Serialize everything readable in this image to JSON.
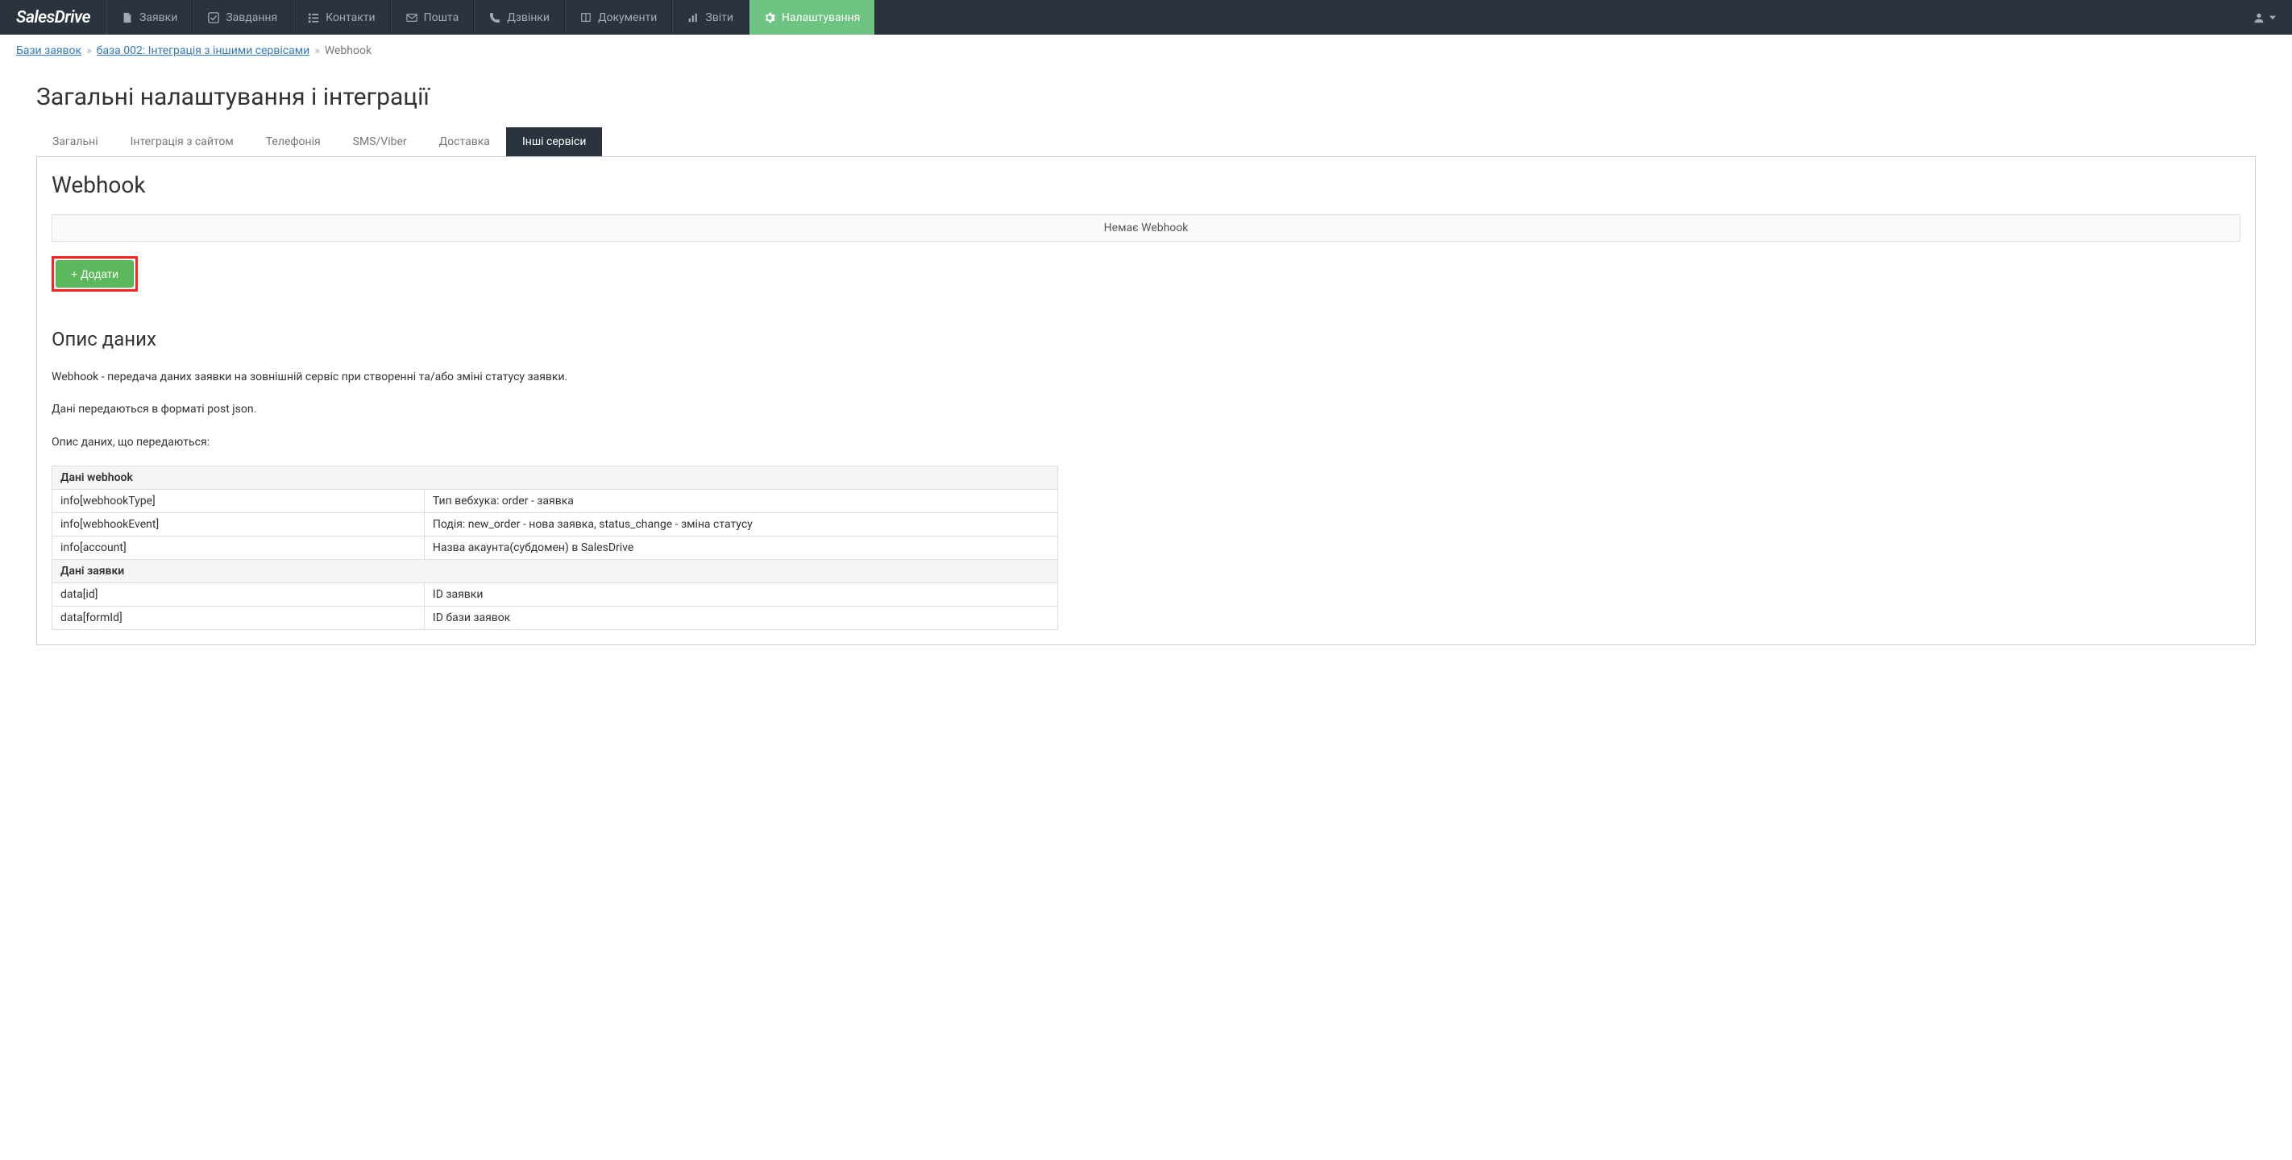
{
  "logo": "SalesDrive",
  "nav": [
    {
      "label": "Заявки",
      "icon": "file"
    },
    {
      "label": "Завдання",
      "icon": "check"
    },
    {
      "label": "Контакти",
      "icon": "list"
    },
    {
      "label": "Пошта",
      "icon": "mail"
    },
    {
      "label": "Дзвінки",
      "icon": "phone"
    },
    {
      "label": "Документи",
      "icon": "book"
    },
    {
      "label": "Звіти",
      "icon": "chart"
    },
    {
      "label": "Налаштування",
      "icon": "gear",
      "active": true
    }
  ],
  "breadcrumb": {
    "items": [
      {
        "label": "Бази заявок",
        "link": true
      },
      {
        "label": "база 002: Інтеграція з іншими сервісами",
        "link": true
      },
      {
        "label": "Webhook",
        "link": false
      }
    ]
  },
  "pageTitle": "Загальні налаштування і інтеграції",
  "tabs": [
    {
      "label": "Загальні"
    },
    {
      "label": "Інтеграція з сайтом"
    },
    {
      "label": "Телефонія"
    },
    {
      "label": "SMS/Viber"
    },
    {
      "label": "Доставка"
    },
    {
      "label": "Інші сервіси",
      "active": true
    }
  ],
  "sectionTitle": "Webhook",
  "emptyMessage": "Немає Webhook",
  "addButton": "+ Додати",
  "descTitle": "Опис даних",
  "descParagraphs": [
    "Webhook - передача даних заявки на зовнішній сервіс при створенні та/або зміні статусу заявки.",
    "Дані передаються в форматі post json.",
    "Опис даних, що передаються:"
  ],
  "dataTable": [
    {
      "type": "section",
      "label": "Дані webhook"
    },
    {
      "type": "row",
      "key": "info[webhookType]",
      "desc": "Тип вебхука: order - заявка"
    },
    {
      "type": "row",
      "key": "info[webhookEvent]",
      "desc": "Подія: new_order - нова заявка, status_change - зміна статусу"
    },
    {
      "type": "row",
      "key": "info[account]",
      "desc": "Назва акаунта(субдомен) в SalesDrive"
    },
    {
      "type": "section",
      "label": "Дані заявки"
    },
    {
      "type": "row",
      "key": "data[id]",
      "desc": "ID заявки"
    },
    {
      "type": "row",
      "key": "data[formId]",
      "desc": "ID бази заявок"
    }
  ]
}
